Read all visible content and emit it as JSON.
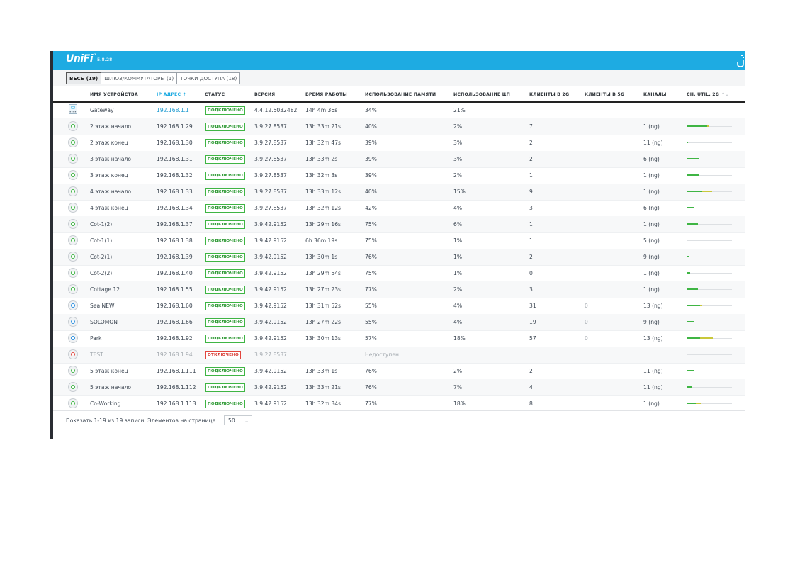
{
  "app": {
    "logo": "UniFi",
    "version": "5.8.28"
  },
  "tabs": [
    {
      "label": "ВЕСЬ (19)",
      "active": true
    },
    {
      "label": "ШЛЮЗ/КОММУТАТОРЫ (1)",
      "active": false
    },
    {
      "label": "ТОЧКИ ДОСТУПА (18)",
      "active": false
    }
  ],
  "columns": {
    "name": "ИМЯ УСТРОЙСТВА",
    "ip": "IP АДРЕС ↑",
    "status": "СТАТУС",
    "version": "ВЕРСИЯ",
    "uptime": "ВРЕМЯ РАБОТЫ",
    "memory": "ИСПОЛЬЗОВАНИЕ ПАМЯТИ",
    "cpu": "ИСПОЛЬЗОВАНИЕ ЦП",
    "clients2g": "КЛИЕНТЫ В 2G",
    "clients5g": "КЛИЕНТЫ В 5G",
    "channels": "КАНАЛЫ",
    "chutil": "CH. UTIL. 2G"
  },
  "devices": [
    {
      "icon": "gateway-icon",
      "name": "Gateway",
      "ip": "192.168.1.1",
      "status": "ПОДКЛЮЧЕНО",
      "online": true,
      "version": "4.4.12.5032482",
      "uptime": "14h 4m 36s",
      "memory": "34%",
      "cpu": "21%",
      "clients2g": "",
      "clients5g": "",
      "channels": "",
      "util_green": 0,
      "util_yellow": 0,
      "showutil": false
    },
    {
      "icon": "access-point-icon",
      "name": "2 этаж начало",
      "ip": "192.168.1.29",
      "status": "ПОДКЛЮЧЕНО",
      "online": true,
      "version": "3.9.27.8537",
      "uptime": "13h 33m 21s",
      "memory": "40%",
      "cpu": "2%",
      "clients2g": "7",
      "clients5g": "",
      "channels": "1 (ng)",
      "util_green": 0.45,
      "util_yellow": 0.05,
      "showutil": true
    },
    {
      "icon": "access-point-icon",
      "name": "2 этаж конец",
      "ip": "192.168.1.30",
      "status": "ПОДКЛЮЧЕНО",
      "online": true,
      "version": "3.9.27.8537",
      "uptime": "13h 32m 47s",
      "memory": "39%",
      "cpu": "3%",
      "clients2g": "2",
      "clients5g": "",
      "channels": "11 (ng)",
      "util_green": 0.03,
      "util_yellow": 0,
      "showutil": true
    },
    {
      "icon": "access-point-icon",
      "name": "3 этаж начало",
      "ip": "192.168.1.31",
      "status": "ПОДКЛЮЧЕНО",
      "online": true,
      "version": "3.9.27.8537",
      "uptime": "13h 33m 2s",
      "memory": "39%",
      "cpu": "3%",
      "clients2g": "2",
      "clients5g": "",
      "channels": "6 (ng)",
      "util_green": 0.27,
      "util_yellow": 0,
      "showutil": true
    },
    {
      "icon": "access-point-icon",
      "name": "3 этаж конец",
      "ip": "192.168.1.32",
      "status": "ПОДКЛЮЧЕНО",
      "online": true,
      "version": "3.9.27.8537",
      "uptime": "13h 32m 3s",
      "memory": "39%",
      "cpu": "2%",
      "clients2g": "1",
      "clients5g": "",
      "channels": "1 (ng)",
      "util_green": 0.27,
      "util_yellow": 0,
      "showutil": true
    },
    {
      "icon": "access-point-icon",
      "name": "4 этаж начало",
      "ip": "192.168.1.33",
      "status": "ПОДКЛЮЧЕНО",
      "online": true,
      "version": "3.9.27.8537",
      "uptime": "13h 33m 12s",
      "memory": "40%",
      "cpu": "15%",
      "clients2g": "9",
      "clients5g": "",
      "channels": "1 (ng)",
      "util_green": 0.35,
      "util_yellow": 0.22,
      "showutil": true
    },
    {
      "icon": "access-point-icon",
      "name": "4 этаж конец",
      "ip": "192.168.1.34",
      "status": "ПОДКЛЮЧЕНО",
      "online": true,
      "version": "3.9.27.8537",
      "uptime": "13h 32m 12s",
      "memory": "42%",
      "cpu": "4%",
      "clients2g": "3",
      "clients5g": "",
      "channels": "6 (ng)",
      "util_green": 0.15,
      "util_yellow": 0.02,
      "showutil": true
    },
    {
      "icon": "access-point-icon",
      "name": "Cot-1(2)",
      "ip": "192.168.1.37",
      "status": "ПОДКЛЮЧЕНО",
      "online": true,
      "version": "3.9.42.9152",
      "uptime": "13h 29m 16s",
      "memory": "75%",
      "cpu": "6%",
      "clients2g": "1",
      "clients5g": "",
      "channels": "1 (ng)",
      "util_green": 0.25,
      "util_yellow": 0,
      "showutil": true
    },
    {
      "icon": "access-point-icon",
      "name": "Cot-1(1)",
      "ip": "192.168.1.38",
      "status": "ПОДКЛЮЧЕНО",
      "online": true,
      "version": "3.9.42.9152",
      "uptime": "6h 36m 19s",
      "memory": "75%",
      "cpu": "1%",
      "clients2g": "1",
      "clients5g": "",
      "channels": "5 (ng)",
      "util_green": 0.02,
      "util_yellow": 0,
      "showutil": true
    },
    {
      "icon": "access-point-icon",
      "name": "Cot-2(1)",
      "ip": "192.168.1.39",
      "status": "ПОДКЛЮЧЕНО",
      "online": true,
      "version": "3.9.42.9152",
      "uptime": "13h 30m 1s",
      "memory": "76%",
      "cpu": "1%",
      "clients2g": "2",
      "clients5g": "",
      "channels": "9 (ng)",
      "util_green": 0.06,
      "util_yellow": 0,
      "showutil": true
    },
    {
      "icon": "access-point-icon",
      "name": "Cot-2(2)",
      "ip": "192.168.1.40",
      "status": "ПОДКЛЮЧЕНО",
      "online": true,
      "version": "3.9.42.9152",
      "uptime": "13h 29m 54s",
      "memory": "75%",
      "cpu": "1%",
      "clients2g": "0",
      "clients5g": "",
      "channels": "1 (ng)",
      "util_green": 0.08,
      "util_yellow": 0,
      "showutil": true
    },
    {
      "icon": "access-point-icon",
      "name": "Cottage 12",
      "ip": "192.168.1.55",
      "status": "ПОДКЛЮЧЕНО",
      "online": true,
      "version": "3.9.42.9152",
      "uptime": "13h 27m 23s",
      "memory": "77%",
      "cpu": "2%",
      "clients2g": "3",
      "clients5g": "",
      "channels": "1 (ng)",
      "util_green": 0.25,
      "util_yellow": 0,
      "showutil": true
    },
    {
      "icon": "access-point-blue-icon",
      "name": "Sea NEW",
      "ip": "192.168.1.60",
      "status": "ПОДКЛЮЧЕНО",
      "online": true,
      "version": "3.9.42.9152",
      "uptime": "13h 31m 52s",
      "memory": "55%",
      "cpu": "4%",
      "clients2g": "31",
      "clients5g": "0",
      "channels": "13 (ng)",
      "util_green": 0.3,
      "util_yellow": 0.05,
      "showutil": true
    },
    {
      "icon": "access-point-blue-icon",
      "name": "SOLOMON",
      "ip": "192.168.1.66",
      "status": "ПОДКЛЮЧЕНО",
      "online": true,
      "version": "3.9.42.9152",
      "uptime": "13h 27m 22s",
      "memory": "55%",
      "cpu": "4%",
      "clients2g": "19",
      "clients5g": "0",
      "channels": "9 (ng)",
      "util_green": 0.15,
      "util_yellow": 0,
      "showutil": true
    },
    {
      "icon": "access-point-blue-icon",
      "name": "Park",
      "ip": "192.168.1.92",
      "status": "ПОДКЛЮЧЕНО",
      "online": true,
      "version": "3.9.42.9152",
      "uptime": "13h 30m 13s",
      "memory": "57%",
      "cpu": "18%",
      "clients2g": "57",
      "clients5g": "0",
      "channels": "13 (ng)",
      "util_green": 0.3,
      "util_yellow": 0.28,
      "showutil": true
    },
    {
      "icon": "access-point-offline-icon",
      "name": "TEST",
      "ip": "192.168.1.94",
      "status": "ОТКЛЮЧЕНО",
      "online": false,
      "version": "3.9.27.8537",
      "uptime": "",
      "memory": "Недоступен",
      "cpu": "",
      "clients2g": "",
      "clients5g": "",
      "channels": "",
      "util_green": 0,
      "util_yellow": 0,
      "showutil": true
    },
    {
      "icon": "access-point-icon",
      "name": "5 этаж конец",
      "ip": "192.168.1.111",
      "status": "ПОДКЛЮЧЕНО",
      "online": true,
      "version": "3.9.42.9152",
      "uptime": "13h 33m 1s",
      "memory": "76%",
      "cpu": "2%",
      "clients2g": "2",
      "clients5g": "",
      "channels": "11 (ng)",
      "util_green": 0.15,
      "util_yellow": 0,
      "showutil": true
    },
    {
      "icon": "access-point-icon",
      "name": "5 этаж начало",
      "ip": "192.168.1.112",
      "status": "ПОДКЛЮЧЕНО",
      "online": true,
      "version": "3.9.42.9152",
      "uptime": "13h 33m 21s",
      "memory": "76%",
      "cpu": "7%",
      "clients2g": "4",
      "clients5g": "",
      "channels": "11 (ng)",
      "util_green": 0.12,
      "util_yellow": 0,
      "showutil": true
    },
    {
      "icon": "access-point-icon",
      "name": "Co-Working",
      "ip": "192.168.1.113",
      "status": "ПОДКЛЮЧЕНО",
      "online": true,
      "version": "3.9.42.9152",
      "uptime": "13h 32m 34s",
      "memory": "77%",
      "cpu": "18%",
      "clients2g": "8",
      "clients5g": "",
      "channels": "1 (ng)",
      "util_green": 0.2,
      "util_yellow": 0.12,
      "showutil": true
    }
  ],
  "footer": {
    "summary": "Показать 1-19 из 19 записи.   Элементов на странице:",
    "page_size": "50"
  },
  "colors": {
    "topbar": "#1eabe2",
    "online": "#3fb544",
    "offline": "#e2453d",
    "util_yellow": "#c9c83a"
  }
}
